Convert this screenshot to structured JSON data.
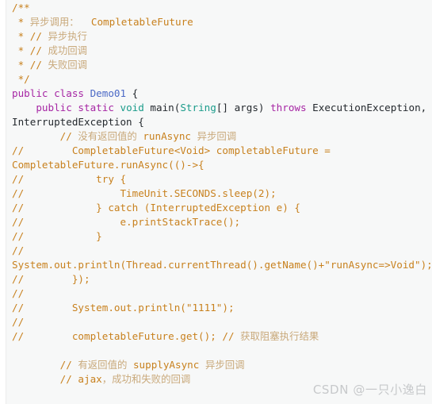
{
  "editor": {
    "background": "#f7f8f8",
    "page_background": "#ffffff",
    "language": "java",
    "colors": {
      "comment": "#c8811e",
      "comment_cjk": "#c9a97b",
      "keyword": "#a626a4",
      "type": "#1a9b8a",
      "class_name": "#4b69c6",
      "plain_text": "#24292e",
      "watermark": "#c7c9cb"
    }
  },
  "code": {
    "lines": [
      {
        "id": "l1",
        "indent": 0,
        "tokens": [
          {
            "t": "cmt",
            "v": "/**"
          }
        ]
      },
      {
        "id": "l2",
        "indent": 0,
        "tokens": [
          {
            "t": "cmt",
            "v": " * "
          },
          {
            "t": "cmt-cjk",
            "v": "异步调用："
          },
          {
            "t": "cmt",
            "v": "  CompletableFuture"
          }
        ]
      },
      {
        "id": "l3",
        "indent": 0,
        "tokens": [
          {
            "t": "cmt",
            "v": " * // "
          },
          {
            "t": "cmt-cjk",
            "v": "异步执行"
          }
        ]
      },
      {
        "id": "l4",
        "indent": 0,
        "tokens": [
          {
            "t": "cmt",
            "v": " * // "
          },
          {
            "t": "cmt-cjk",
            "v": "成功回调"
          }
        ]
      },
      {
        "id": "l5",
        "indent": 0,
        "tokens": [
          {
            "t": "cmt",
            "v": " * // "
          },
          {
            "t": "cmt-cjk",
            "v": "失败回调"
          }
        ]
      },
      {
        "id": "l6",
        "indent": 0,
        "tokens": [
          {
            "t": "cmt",
            "v": " */"
          }
        ]
      },
      {
        "id": "l7",
        "indent": 0,
        "tokens": [
          {
            "t": "kw",
            "v": "public class "
          },
          {
            "t": "cls",
            "v": "Demo01"
          },
          {
            "t": "plain",
            "v": " {"
          }
        ]
      },
      {
        "id": "l8",
        "indent": 0,
        "tokens": [
          {
            "t": "plain",
            "v": "    "
          },
          {
            "t": "kw",
            "v": "public static "
          },
          {
            "t": "type",
            "v": "void "
          },
          {
            "t": "plain",
            "v": "main("
          },
          {
            "t": "type",
            "v": "String"
          },
          {
            "t": "plain",
            "v": "[] args) "
          },
          {
            "t": "kw",
            "v": "throws "
          },
          {
            "t": "plain",
            "v": "ExecutionException,"
          }
        ]
      },
      {
        "id": "l9",
        "indent": 0,
        "tokens": [
          {
            "t": "plain",
            "v": "InterruptedException {"
          }
        ]
      },
      {
        "id": "l10",
        "indent": 0,
        "tokens": [
          {
            "t": "cmt",
            "v": "        // "
          },
          {
            "t": "cmt-cjk",
            "v": "没有返回值的"
          },
          {
            "t": "cmt",
            "v": " runAsync "
          },
          {
            "t": "cmt-cjk",
            "v": "异步回调"
          }
        ]
      },
      {
        "id": "l11",
        "indent": 0,
        "tokens": [
          {
            "t": "cmt",
            "v": "//        CompletableFuture<Void> completableFuture ="
          }
        ]
      },
      {
        "id": "l12",
        "indent": 0,
        "tokens": [
          {
            "t": "cmt",
            "v": "CompletableFuture.runAsync(()->{"
          }
        ]
      },
      {
        "id": "l13",
        "indent": 0,
        "tokens": [
          {
            "t": "cmt",
            "v": "//            try {"
          }
        ]
      },
      {
        "id": "l14",
        "indent": 0,
        "tokens": [
          {
            "t": "cmt",
            "v": "//                TimeUnit.SECONDS.sleep(2);"
          }
        ]
      },
      {
        "id": "l15",
        "indent": 0,
        "tokens": [
          {
            "t": "cmt",
            "v": "//            } catch (InterruptedException e) {"
          }
        ]
      },
      {
        "id": "l16",
        "indent": 0,
        "tokens": [
          {
            "t": "cmt",
            "v": "//                e.printStackTrace();"
          }
        ]
      },
      {
        "id": "l17",
        "indent": 0,
        "tokens": [
          {
            "t": "cmt",
            "v": "//            }"
          }
        ]
      },
      {
        "id": "l18",
        "indent": 0,
        "tokens": [
          {
            "t": "cmt",
            "v": "//"
          }
        ]
      },
      {
        "id": "l19",
        "indent": 0,
        "tokens": [
          {
            "t": "cmt",
            "v": "System.out.println(Thread.currentThread().getName()+\"runAsync=>Void\");"
          }
        ]
      },
      {
        "id": "l20",
        "indent": 0,
        "tokens": [
          {
            "t": "cmt",
            "v": "//        });"
          }
        ]
      },
      {
        "id": "l21",
        "indent": 0,
        "tokens": [
          {
            "t": "cmt",
            "v": "//"
          }
        ]
      },
      {
        "id": "l22",
        "indent": 0,
        "tokens": [
          {
            "t": "cmt",
            "v": "//        System.out.println(\"1111\");"
          }
        ]
      },
      {
        "id": "l23",
        "indent": 0,
        "tokens": [
          {
            "t": "cmt",
            "v": "//"
          }
        ]
      },
      {
        "id": "l24",
        "indent": 0,
        "tokens": [
          {
            "t": "cmt",
            "v": "//        completableFuture.get(); // "
          },
          {
            "t": "cmt-cjk",
            "v": "获取阻塞执行结果"
          }
        ]
      },
      {
        "id": "l25",
        "indent": 0,
        "tokens": []
      },
      {
        "id": "l26",
        "indent": 0,
        "tokens": [
          {
            "t": "cmt",
            "v": "        // "
          },
          {
            "t": "cmt-cjk",
            "v": "有返回值的"
          },
          {
            "t": "cmt",
            "v": " supplyAsync "
          },
          {
            "t": "cmt-cjk",
            "v": "异步回调"
          }
        ]
      },
      {
        "id": "l27",
        "indent": 0,
        "tokens": [
          {
            "t": "cmt",
            "v": "        // ajax"
          },
          {
            "t": "cmt-cjk",
            "v": "，成功和失败的回调"
          }
        ]
      }
    ]
  },
  "watermark": {
    "text": "CSDN @一只小逸白"
  }
}
